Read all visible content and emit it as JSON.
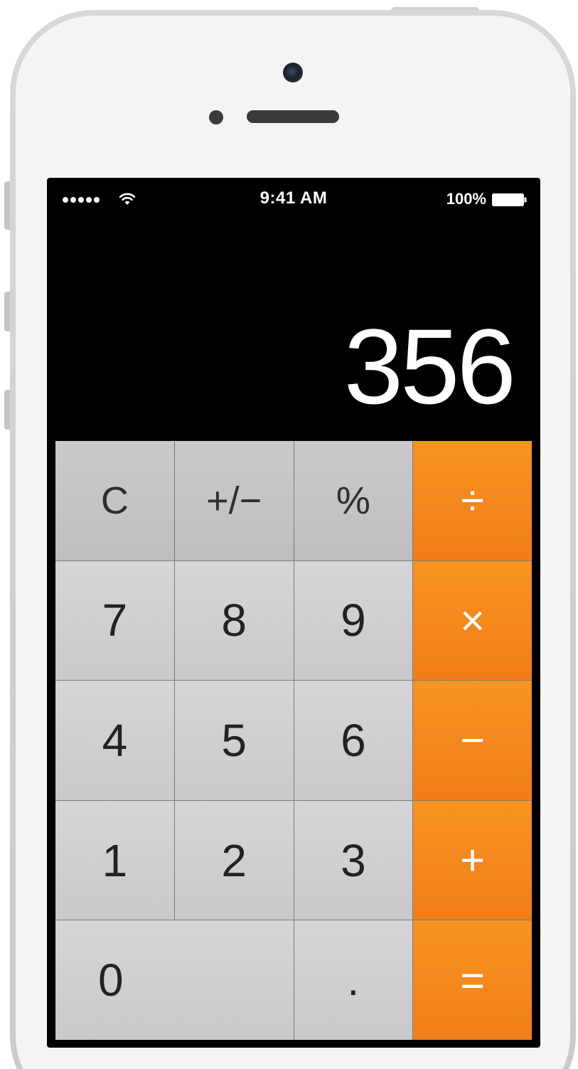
{
  "status_bar": {
    "signal_dots": 5,
    "time": "9:41 AM",
    "battery_percent": "100%",
    "wifi_icon": "wifi-icon",
    "battery_icon": "battery-icon"
  },
  "display": {
    "value": "356"
  },
  "keys": {
    "clear": "C",
    "sign": "+/−",
    "percent": "%",
    "divide": "÷",
    "seven": "7",
    "eight": "8",
    "nine": "9",
    "multiply": "×",
    "four": "4",
    "five": "5",
    "six": "6",
    "subtract": "−",
    "one": "1",
    "two": "2",
    "three": "3",
    "add": "+",
    "zero": "0",
    "decimal": ".",
    "equals": "="
  },
  "colors": {
    "operator_key": "#f48f20",
    "function_key": "#c4c4c6",
    "digit_key": "#d0d0d2",
    "screen_background": "#000000",
    "phone_body": "#f4f4f5"
  }
}
